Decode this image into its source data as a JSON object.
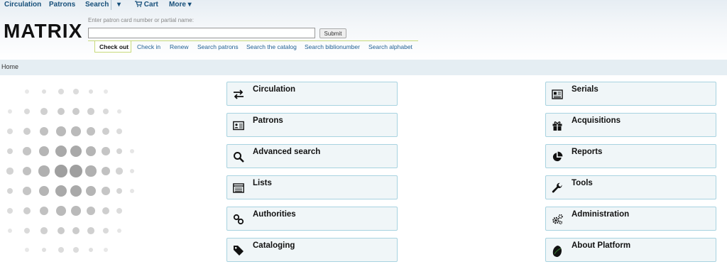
{
  "topnav": {
    "circulation": "Circulation",
    "patrons": "Patrons",
    "search": "Search",
    "search_dropdown": "▾",
    "cart": "Cart",
    "more": "More ▾"
  },
  "logo": {
    "text": "MATRIX"
  },
  "search": {
    "hint": "Enter patron card number or partial name:",
    "value": "",
    "submit": "Submit"
  },
  "tabs": [
    {
      "label": "Check out"
    },
    {
      "label": "Check in"
    },
    {
      "label": "Renew"
    },
    {
      "label": "Search patrons"
    },
    {
      "label": "Search the catalog"
    },
    {
      "label": "Search biblionumber"
    },
    {
      "label": "Search alphabet"
    }
  ],
  "breadcrumb": {
    "home": "Home"
  },
  "left_menu": [
    {
      "label": "Circulation",
      "icon": "swap-arrows-icon"
    },
    {
      "label": "Patrons",
      "icon": "id-card-icon"
    },
    {
      "label": "Advanced search",
      "icon": "magnifier-icon"
    },
    {
      "label": "Lists",
      "icon": "list-icon"
    },
    {
      "label": "Authorities",
      "icon": "link-icon"
    },
    {
      "label": "Cataloging",
      "icon": "tag-icon"
    }
  ],
  "right_menu": [
    {
      "label": "Serials",
      "icon": "newspaper-icon"
    },
    {
      "label": "Acquisitions",
      "icon": "gift-icon"
    },
    {
      "label": "Reports",
      "icon": "pie-chart-icon"
    },
    {
      "label": "Tools",
      "icon": "wrench-icon"
    },
    {
      "label": "Administration",
      "icon": "gears-icon"
    },
    {
      "label": "About Platform",
      "icon": "leaf-logo-icon"
    }
  ]
}
